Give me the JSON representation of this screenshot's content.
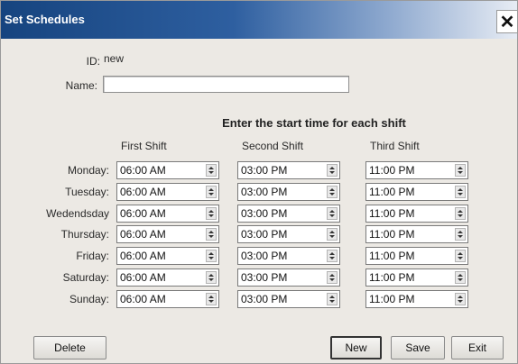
{
  "window": {
    "title": "Set Schedules",
    "close_glyph": "✕"
  },
  "form": {
    "id_label": "ID:",
    "id_value": "new",
    "name_label": "Name:",
    "name_value": ""
  },
  "schedule": {
    "heading": "Enter the start time for each shift",
    "columns": [
      "First Shift",
      "Second Shift",
      "Third Shift"
    ],
    "rows": [
      {
        "day": "Monday:",
        "times": [
          "06:00 AM",
          "03:00 PM",
          "11:00 PM"
        ]
      },
      {
        "day": "Tuesday:",
        "times": [
          "06:00 AM",
          "03:00 PM",
          "11:00 PM"
        ]
      },
      {
        "day": "Wedendsday",
        "times": [
          "06:00 AM",
          "03:00 PM",
          "11:00 PM"
        ]
      },
      {
        "day": "Thursday:",
        "times": [
          "06:00 AM",
          "03:00 PM",
          "11:00 PM"
        ]
      },
      {
        "day": "Friday:",
        "times": [
          "06:00 AM",
          "03:00 PM",
          "11:00 PM"
        ]
      },
      {
        "day": "Saturday:",
        "times": [
          "06:00 AM",
          "03:00 PM",
          "11:00 PM"
        ]
      },
      {
        "day": "Sunday:",
        "times": [
          "06:00 AM",
          "03:00 PM",
          "11:00 PM"
        ]
      }
    ]
  },
  "buttons": {
    "delete": "Delete",
    "new": "New",
    "save": "Save",
    "exit": "Exit"
  }
}
